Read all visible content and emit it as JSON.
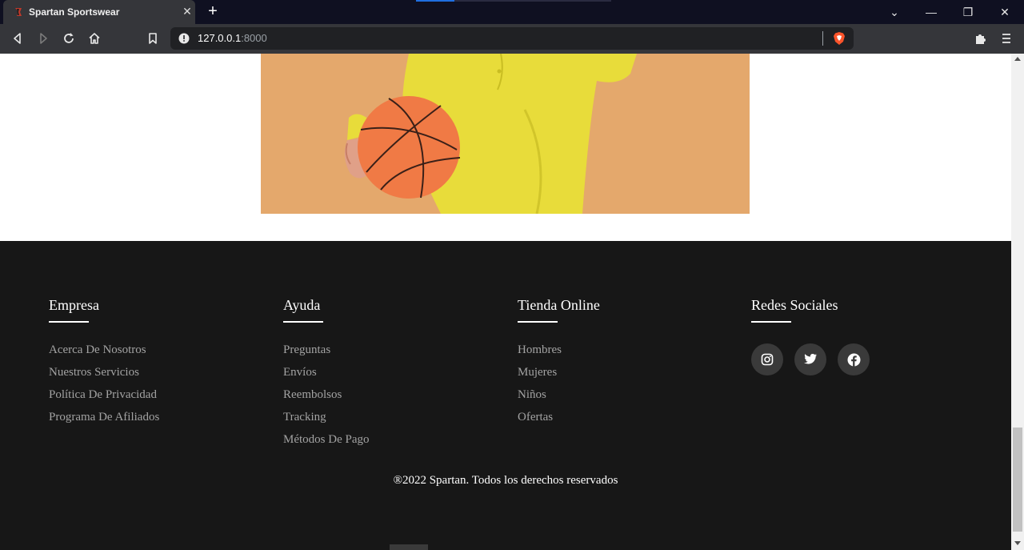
{
  "browser": {
    "tab_title": "Spartan Sportswear",
    "tab_close": "✕",
    "new_tab": "+",
    "url_host": "127.0.0.1",
    "url_port": ":8000",
    "window_controls": {
      "tab_search": "⌄",
      "minimize": "—",
      "restore": "❐",
      "close": "✕"
    }
  },
  "hero": {
    "image": "child-in-yellow-shirt-holding-basketball"
  },
  "footer": {
    "columns": [
      {
        "title": "Empresa",
        "links": [
          "Acerca De Nosotros",
          "Nuestros Servicios",
          "Política De Privacidad",
          "Programa De Afiliados"
        ]
      },
      {
        "title": "Ayuda",
        "links": [
          "Preguntas",
          "Envíos",
          "Reembolsos",
          "Tracking",
          "Métodos De Pago"
        ]
      },
      {
        "title": "Tienda Online",
        "links": [
          "Hombres",
          "Mujeres",
          "Niños",
          "Ofertas"
        ]
      },
      {
        "title": "Redes Sociales",
        "social": [
          "instagram-icon",
          "twitter-icon",
          "facebook-icon"
        ]
      }
    ],
    "copyright": "®2022 Spartan. Todos los derechos reservados"
  },
  "colors": {
    "footer_bg": "#171717",
    "link": "#a3a3a3",
    "hero_bg": "#e4a86c",
    "shirt": "#e8dc3a",
    "ball": "#f07a45"
  }
}
